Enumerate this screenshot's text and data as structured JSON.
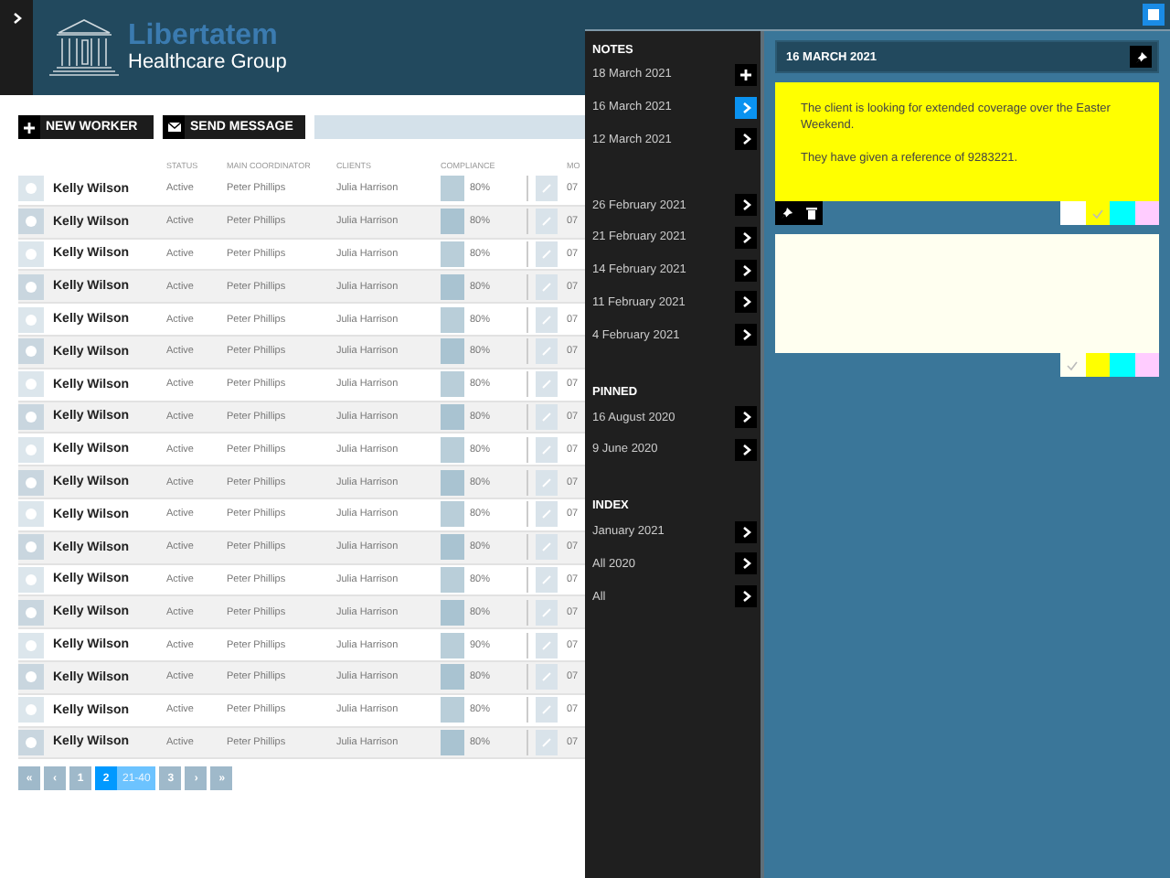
{
  "header": {
    "logo_title": "Libertatem",
    "logo_subtitle": "Healthcare Group"
  },
  "toolbar": {
    "buttons": [
      {
        "label": "NEW WORKER",
        "kind": "plus"
      },
      {
        "label": "SEND MESSAGE",
        "kind": "mail"
      }
    ]
  },
  "table": {
    "columns": [
      "STATUS",
      "MAIN COORDINATOR",
      "CLIENTS",
      "COMPLIANCE",
      "MO"
    ],
    "rows": [
      {
        "name": "Kelly Wilson",
        "status": "Active",
        "coordinator": "Peter Phillips",
        "client": "Julia Harrison",
        "compliance": "80%",
        "column_5": "07"
      },
      {
        "name": "Kelly Wilson",
        "status": "Active",
        "coordinator": "Peter Phillips",
        "client": "Julia Harrison",
        "compliance": "80%",
        "column_5": "07"
      },
      {
        "name": "Kelly Wilson",
        "status": "Active",
        "coordinator": "Peter Phillips",
        "client": "Julia Harrison",
        "compliance": "80%",
        "column_5": "07"
      },
      {
        "name": "Kelly Wilson",
        "status": "Active",
        "coordinator": "Peter Phillips",
        "client": "Julia Harrison",
        "compliance": "80%",
        "column_5": "07"
      },
      {
        "name": "Kelly Wilson",
        "status": "Active",
        "coordinator": "Peter Phillips",
        "client": "Julia Harrison",
        "compliance": "80%",
        "column_5": "07"
      },
      {
        "name": "Kelly Wilson",
        "status": "Active",
        "coordinator": "Peter Phillips",
        "client": "Julia Harrison",
        "compliance": "80%",
        "column_5": "07"
      },
      {
        "name": "Kelly Wilson",
        "status": "Active",
        "coordinator": "Peter Phillips",
        "client": "Julia Harrison",
        "compliance": "80%",
        "column_5": "07"
      },
      {
        "name": "Kelly Wilson",
        "status": "Active",
        "coordinator": "Peter Phillips",
        "client": "Julia Harrison",
        "compliance": "80%",
        "column_5": "07"
      },
      {
        "name": "Kelly Wilson",
        "status": "Active",
        "coordinator": "Peter Phillips",
        "client": "Julia Harrison",
        "compliance": "80%",
        "column_5": "07"
      },
      {
        "name": "Kelly Wilson",
        "status": "Active",
        "coordinator": "Peter Phillips",
        "client": "Julia Harrison",
        "compliance": "80%",
        "column_5": "07"
      },
      {
        "name": "Kelly Wilson",
        "status": "Active",
        "coordinator": "Peter Phillips",
        "client": "Julia Harrison",
        "compliance": "80%",
        "column_5": "07"
      },
      {
        "name": "Kelly Wilson",
        "status": "Active",
        "coordinator": "Peter Phillips",
        "client": "Julia Harrison",
        "compliance": "80%",
        "column_5": "07"
      },
      {
        "name": "Kelly Wilson",
        "status": "Active",
        "coordinator": "Peter Phillips",
        "client": "Julia Harrison",
        "compliance": "80%",
        "column_5": "07"
      },
      {
        "name": "Kelly Wilson",
        "status": "Active",
        "coordinator": "Peter Phillips",
        "client": "Julia Harrison",
        "compliance": "80%",
        "column_5": "07"
      },
      {
        "name": "Kelly Wilson",
        "status": "Active",
        "coordinator": "Peter Phillips",
        "client": "Julia Harrison",
        "compliance": "90%",
        "column_5": "07"
      },
      {
        "name": "Kelly Wilson",
        "status": "Active",
        "coordinator": "Peter Phillips",
        "client": "Julia Harrison",
        "compliance": "80%",
        "column_5": "07"
      },
      {
        "name": "Kelly Wilson",
        "status": "Active",
        "coordinator": "Peter Phillips",
        "client": "Julia Harrison",
        "compliance": "80%",
        "column_5": "07"
      },
      {
        "name": "Kelly Wilson",
        "status": "Active",
        "coordinator": "Peter Phillips",
        "client": "Julia Harrison",
        "compliance": "80%",
        "column_5": "07"
      }
    ]
  },
  "pagination": {
    "first": "«",
    "prev": "‹",
    "pages": [
      {
        "label": "1",
        "selected": false
      },
      {
        "label": "2",
        "selected": true,
        "range": "21-40"
      },
      {
        "label": "3",
        "selected": false
      }
    ],
    "next": "›",
    "last": "»"
  },
  "notes_sidebar": {
    "sections": [
      {
        "title": "NOTES",
        "items": [
          {
            "label": "18 March 2021",
            "kind": "add",
            "selected": false
          },
          {
            "label": "16 March 2021",
            "kind": "open",
            "selected": true
          },
          {
            "label": "12 March 2021",
            "kind": "open",
            "selected": false
          },
          {
            "kind": "gap"
          },
          {
            "label": "26 February 2021",
            "kind": "open",
            "selected": false
          },
          {
            "label": "21 February 2021",
            "kind": "open",
            "selected": false
          },
          {
            "label": "14 February 2021",
            "kind": "open",
            "selected": false
          },
          {
            "label": "11 February 2021",
            "kind": "open",
            "selected": false
          },
          {
            "label": "4 February 2021",
            "kind": "open",
            "selected": false
          }
        ]
      },
      {
        "title": "PINNED",
        "items": [
          {
            "label": "16 August 2020",
            "kind": "open",
            "selected": false
          },
          {
            "label": "9 June 2020",
            "kind": "open",
            "selected": false
          }
        ]
      },
      {
        "title": "INDEX",
        "items": [
          {
            "label": "January 2021",
            "kind": "open",
            "selected": false
          },
          {
            "label": "All 2020",
            "kind": "open",
            "selected": false
          },
          {
            "label": "All",
            "kind": "open",
            "selected": false
          }
        ]
      }
    ]
  },
  "note_panel": {
    "title": "16 MARCH 2021",
    "notes": [
      {
        "paragraphs": [
          "The client is looking for extended coverage over the Easter Weekend.",
          "They have given a reference of 9283221."
        ],
        "toolbar": true,
        "swatches": [
          {
            "color": "#ffffff",
            "checked": false
          },
          {
            "color": "#ffff00",
            "checked": true
          },
          {
            "color": "#00ffff",
            "checked": false
          },
          {
            "color": "#ffccff",
            "checked": false
          }
        ]
      },
      {
        "swatches": [
          {
            "color": "#fffff0",
            "checked": true
          },
          {
            "color": "#ffff00",
            "checked": false
          },
          {
            "color": "#00ffff",
            "checked": false
          },
          {
            "color": "#ffccff",
            "checked": false
          }
        ]
      }
    ]
  }
}
